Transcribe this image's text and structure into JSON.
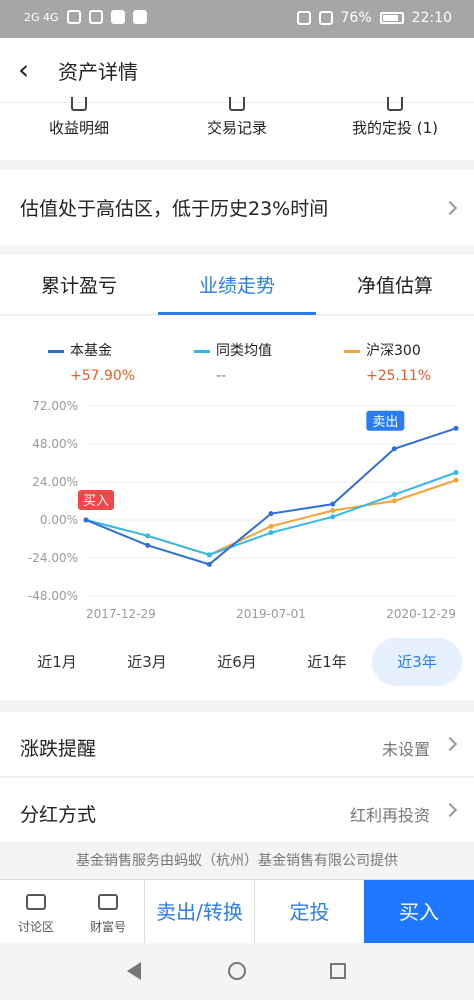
{
  "status_bar": {
    "signal_left": "2G 4G",
    "battery": "76%",
    "time": "22:10"
  },
  "header": {
    "title": "资产详情"
  },
  "quick_links": [
    {
      "label": "收益明细"
    },
    {
      "label": "交易记录"
    },
    {
      "label": "我的定投 (1)"
    }
  ],
  "valuation": {
    "text": "估值处于高估区，低于历史23%时间"
  },
  "tabs": [
    {
      "label": "累计盈亏"
    },
    {
      "label": "业绩走势"
    },
    {
      "label": "净值估算"
    }
  ],
  "legend": [
    {
      "name": "本基金",
      "value": "+57.90%",
      "color": "#2f6fd6"
    },
    {
      "name": "同类均值",
      "value": "--",
      "color": "#36b7ea"
    },
    {
      "name": "沪深300",
      "value": "+25.11%",
      "color": "#f2a33a"
    }
  ],
  "chart_data": {
    "type": "line",
    "x": [
      "2017-12-29",
      "2018-06-30",
      "2018-12-31",
      "2019-07-01",
      "2019-12-31",
      "2020-06-30",
      "2020-12-29"
    ],
    "ylim": [
      -48,
      72
    ],
    "yticks": [
      "72.00%",
      "48.00%",
      "24.00%",
      "0.00%",
      "-24.00%",
      "-48.00%"
    ],
    "xticks": [
      "2017-12-29",
      "2019-07-01",
      "2020-12-29"
    ],
    "series": [
      {
        "name": "本基金",
        "values": [
          0,
          -16,
          -28,
          4,
          10,
          45,
          57.9
        ],
        "color": "#2f6fd6"
      },
      {
        "name": "同类均值",
        "values": [
          0,
          -10,
          -22,
          -8,
          2,
          16,
          30
        ],
        "color": "#36b7ea"
      },
      {
        "name": "沪深300",
        "values": [
          0,
          -10,
          -22,
          -4,
          6,
          12,
          25.11
        ],
        "color": "#f2a33a"
      }
    ],
    "markers": {
      "buy": "买入",
      "sell": "卖出"
    },
    "grid": true
  },
  "periods": [
    {
      "label": "近1月"
    },
    {
      "label": "近3月"
    },
    {
      "label": "近6月"
    },
    {
      "label": "近1年"
    },
    {
      "label": "近3年"
    }
  ],
  "settings": [
    {
      "label": "涨跌提醒",
      "value": "未设置"
    },
    {
      "label": "分红方式",
      "value": "红利再投资"
    }
  ],
  "footer_note": "基金销售服务由蚂蚁（杭州）基金销售有限公司提供",
  "bottom_bar": {
    "discuss": "讨论区",
    "wealth": "财富号",
    "sell_transfer": "卖出/转换",
    "fixed_invest": "定投",
    "buy": "买入"
  }
}
